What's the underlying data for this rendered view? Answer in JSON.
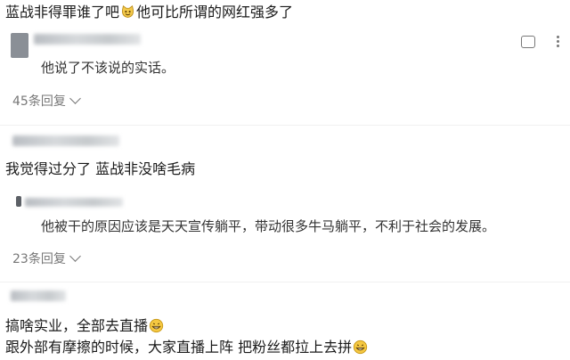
{
  "top_comment": {
    "text_before_emoji": "蓝战非得罪谁了吧",
    "text_after_emoji": "他可比所谓的网红强多了"
  },
  "thread1": {
    "reply": "他说了不该说的实话。",
    "replies_count": "45条回复"
  },
  "thread2": {
    "comment": "我觉得过分了 蓝战非没啥毛病",
    "reply": "他被干的原因应该是天天宣传躺平，带动很多牛马躺平，不利于社会的发展。",
    "replies_count": "23条回复"
  },
  "thread3": {
    "line1": "搞啥实业，全部去直播",
    "line2": "跟外部有摩擦的时候，大家直播上阵 把粉丝都拉上去拼"
  },
  "icons": [
    "cat-emoji-icon",
    "comment-icon",
    "more-icon",
    "chevron-down-icon",
    "grin-emoji-icon"
  ]
}
